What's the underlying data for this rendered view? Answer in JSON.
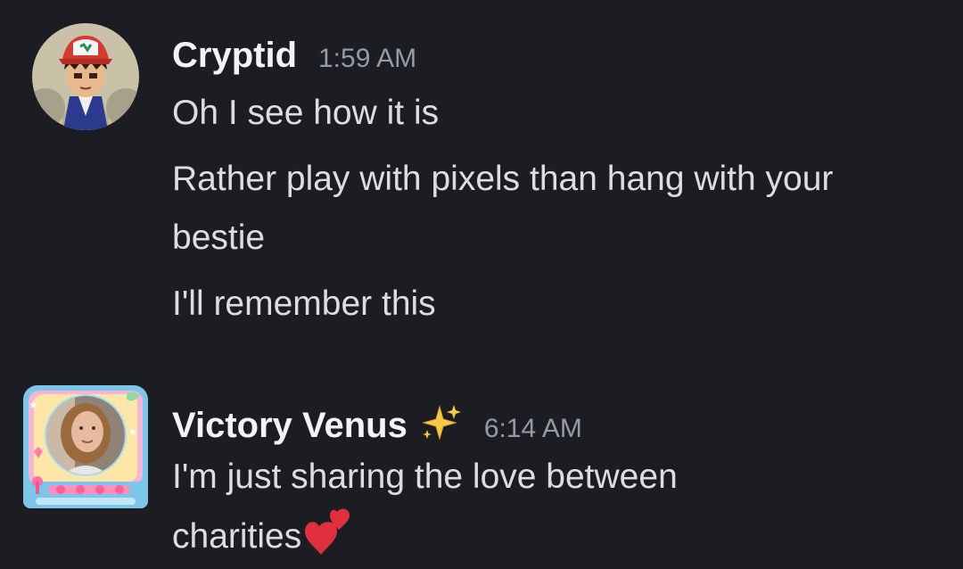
{
  "messages": [
    {
      "username": "Cryptid",
      "timestamp": "1:59 AM",
      "avatar": "anime-character-avatar",
      "lines": [
        "Oh I see how it is",
        "Rather play with pixels than hang with your bestie",
        "I'll remember this"
      ]
    },
    {
      "username": "Victory Venus",
      "username_emoji": "sparkles-icon",
      "timestamp": "6:14 AM",
      "avatar": "arcade-frame-avatar",
      "lines": [
        "I'm just sharing the love between charities"
      ],
      "trailing_emoji": "two-hearts-icon"
    }
  ],
  "colors": {
    "background": "#1c1d22",
    "username": "#f2f3f5",
    "text": "#dbdee1",
    "timestamp": "#949ba4"
  }
}
